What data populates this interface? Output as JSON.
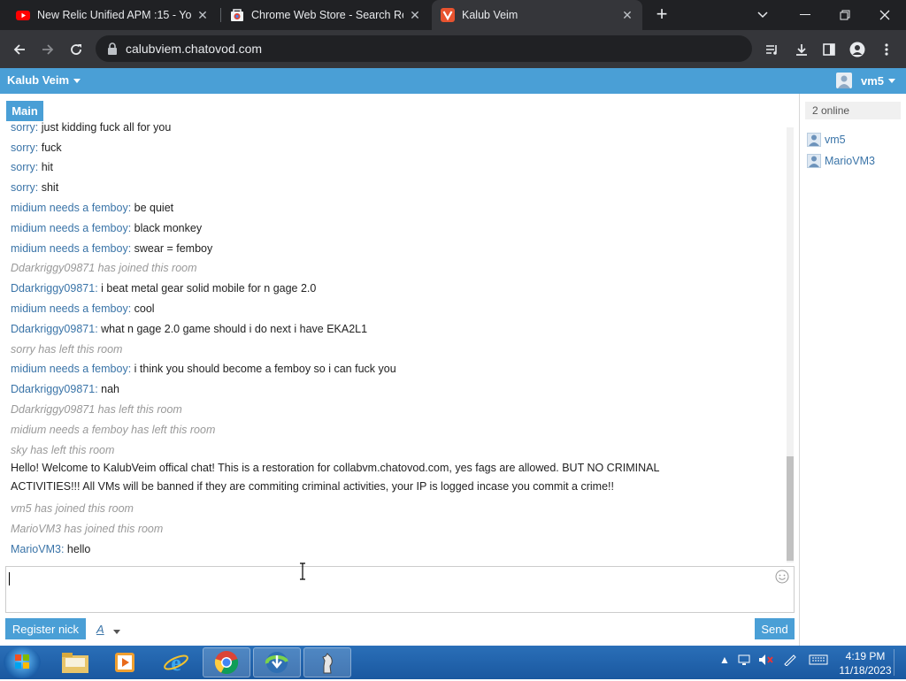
{
  "browser": {
    "tabs": [
      {
        "title": "New Relic Unified APM :15 - You",
        "active": false,
        "favicon": "youtube-icon"
      },
      {
        "title": "Chrome Web Store - Search Res",
        "active": false,
        "favicon": "chrome-web-store-icon"
      },
      {
        "title": "Kalub Veim",
        "active": true,
        "favicon": "chatovod-icon"
      }
    ],
    "url": "calubviem.chatovod.com"
  },
  "app": {
    "room_title": "Kalub Veim",
    "user": "vm5",
    "main_tab": "Main"
  },
  "messages": [
    {
      "nick": "sorry",
      "text": "just kidding fuck all for you",
      "type": "msg"
    },
    {
      "nick": "sorry",
      "text": "fuck",
      "type": "msg"
    },
    {
      "nick": "sorry",
      "text": "hit",
      "type": "msg"
    },
    {
      "nick": "sorry",
      "text": "shit",
      "type": "msg"
    },
    {
      "nick": "midium needs a femboy",
      "text": "be quiet",
      "type": "msg"
    },
    {
      "nick": "midium needs a femboy",
      "text": "black monkey",
      "type": "msg"
    },
    {
      "nick": "midium needs a femboy",
      "text": "swear = femboy",
      "type": "msg"
    },
    {
      "text": "Ddarkriggy09871 has joined this room",
      "type": "sys"
    },
    {
      "nick": "Ddarkriggy09871",
      "text": "i beat metal gear solid mobile for n gage 2.0",
      "type": "msg"
    },
    {
      "nick": "midium needs a femboy",
      "text": "cool",
      "type": "msg"
    },
    {
      "nick": "Ddarkriggy09871",
      "text": "what n gage 2.0 game should i do next i have EKA2L1",
      "type": "msg"
    },
    {
      "text": "sorry has left this room",
      "type": "sys"
    },
    {
      "nick": "midium needs a femboy",
      "text": "i think you should become a femboy so i can fuck you",
      "type": "msg"
    },
    {
      "nick": "Ddarkriggy09871",
      "text": "nah",
      "type": "msg"
    },
    {
      "text": "Ddarkriggy09871 has left this room",
      "type": "sys"
    },
    {
      "text": "midium needs a femboy has left this room",
      "type": "sys"
    },
    {
      "text": "sky has left this room",
      "type": "sys"
    },
    {
      "text": "Hello! Welcome to KalubVeim offical chat! This is a restoration for collabvm.chatovod.com, yes fags are allowed. BUT NO CRIMINAL ACTIVITIES!!! All VMs will be banned if they are commiting criminal activities, your IP is logged incase you commit a crime!!",
      "type": "announce"
    },
    {
      "text": "vm5 has joined this room",
      "type": "sys"
    },
    {
      "text": "MarioVM3 has joined this room",
      "type": "sys"
    },
    {
      "nick": "MarioVM3",
      "text": "hello",
      "type": "msg"
    }
  ],
  "composer": {
    "register_label": "Register nick",
    "font_label": "A",
    "send_label": "Send"
  },
  "sidebar": {
    "online_count": "2 online",
    "users": [
      "vm5",
      "MarioVM3"
    ]
  },
  "taskbar": {
    "time": "4:19 PM",
    "date": "11/18/2023"
  }
}
